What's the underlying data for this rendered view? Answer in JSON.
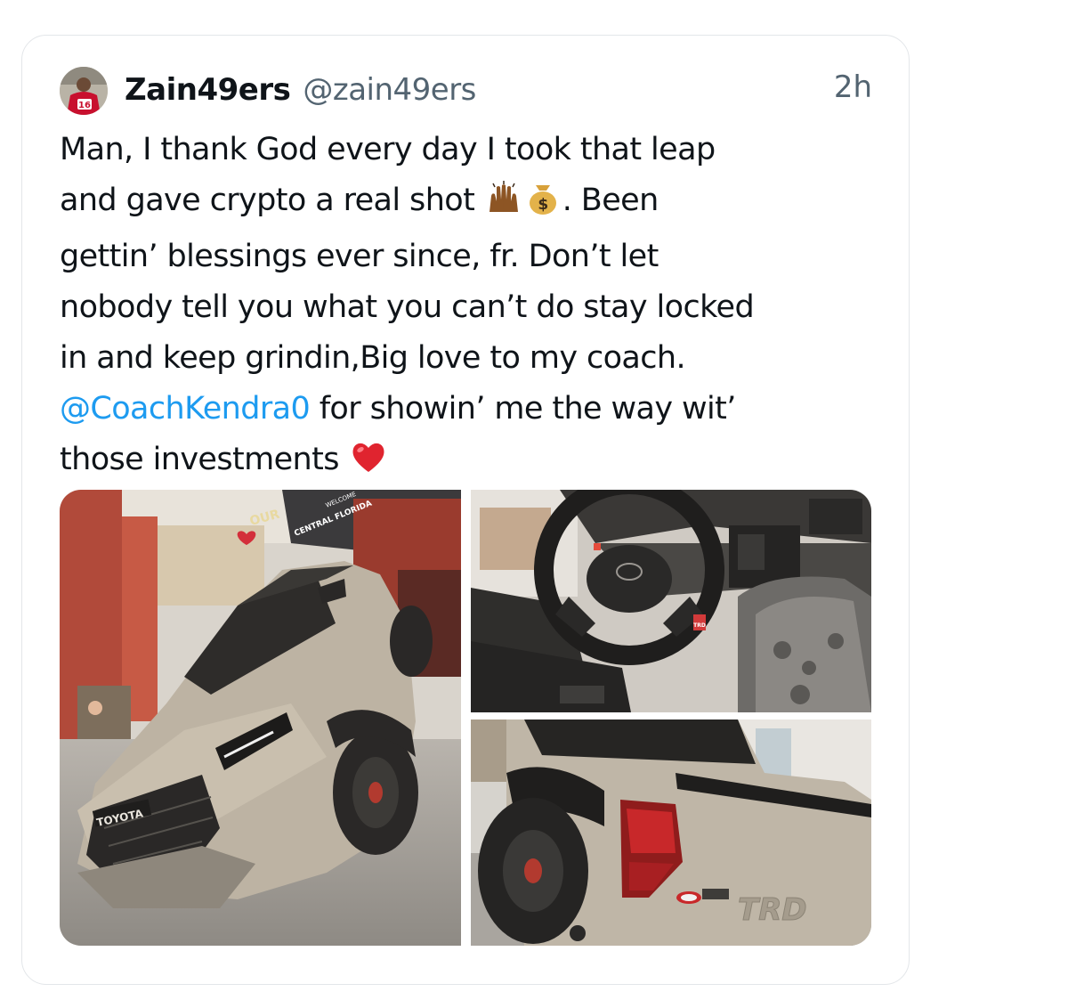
{
  "tweet": {
    "display_name": "Zain49ers",
    "handle": "@zain49ers",
    "time": "2h",
    "avatar_icon": "profile-avatar-icon",
    "avatar_jersey_number": "16",
    "text_lines": {
      "l1": "Man, I thank God every day I took that leap",
      "l2_a": "and gave crypto a real shot",
      "l2_b": ". Been",
      "l3": "gettin’ blessings ever since, fr. Don’t let",
      "l4": "nobody tell you what you can’t do stay locked",
      "l5": "in and keep grindin,Big love to my coach.",
      "l6_mention": "@CoachKendra0",
      "l6_rest": " for showin’ me the way wit’",
      "l7": "those investments"
    },
    "emojis": [
      "raising-hands-icon",
      "money-bag-icon",
      "red-heart-icon"
    ],
    "mention_color": "#1d9bf0",
    "media": {
      "photo_1": {
        "icon": "truck-front-photo",
        "visible_signs": [
          "TOYOTA",
          "CENTRAL FLORIDA",
          "WELCOME",
          "OUR"
        ]
      },
      "photo_2": {
        "icon": "steering-wheel-photo",
        "visible_badge": "TRD"
      },
      "photo_3": {
        "icon": "truck-rear-photo",
        "visible_badge": "TRD"
      }
    }
  }
}
